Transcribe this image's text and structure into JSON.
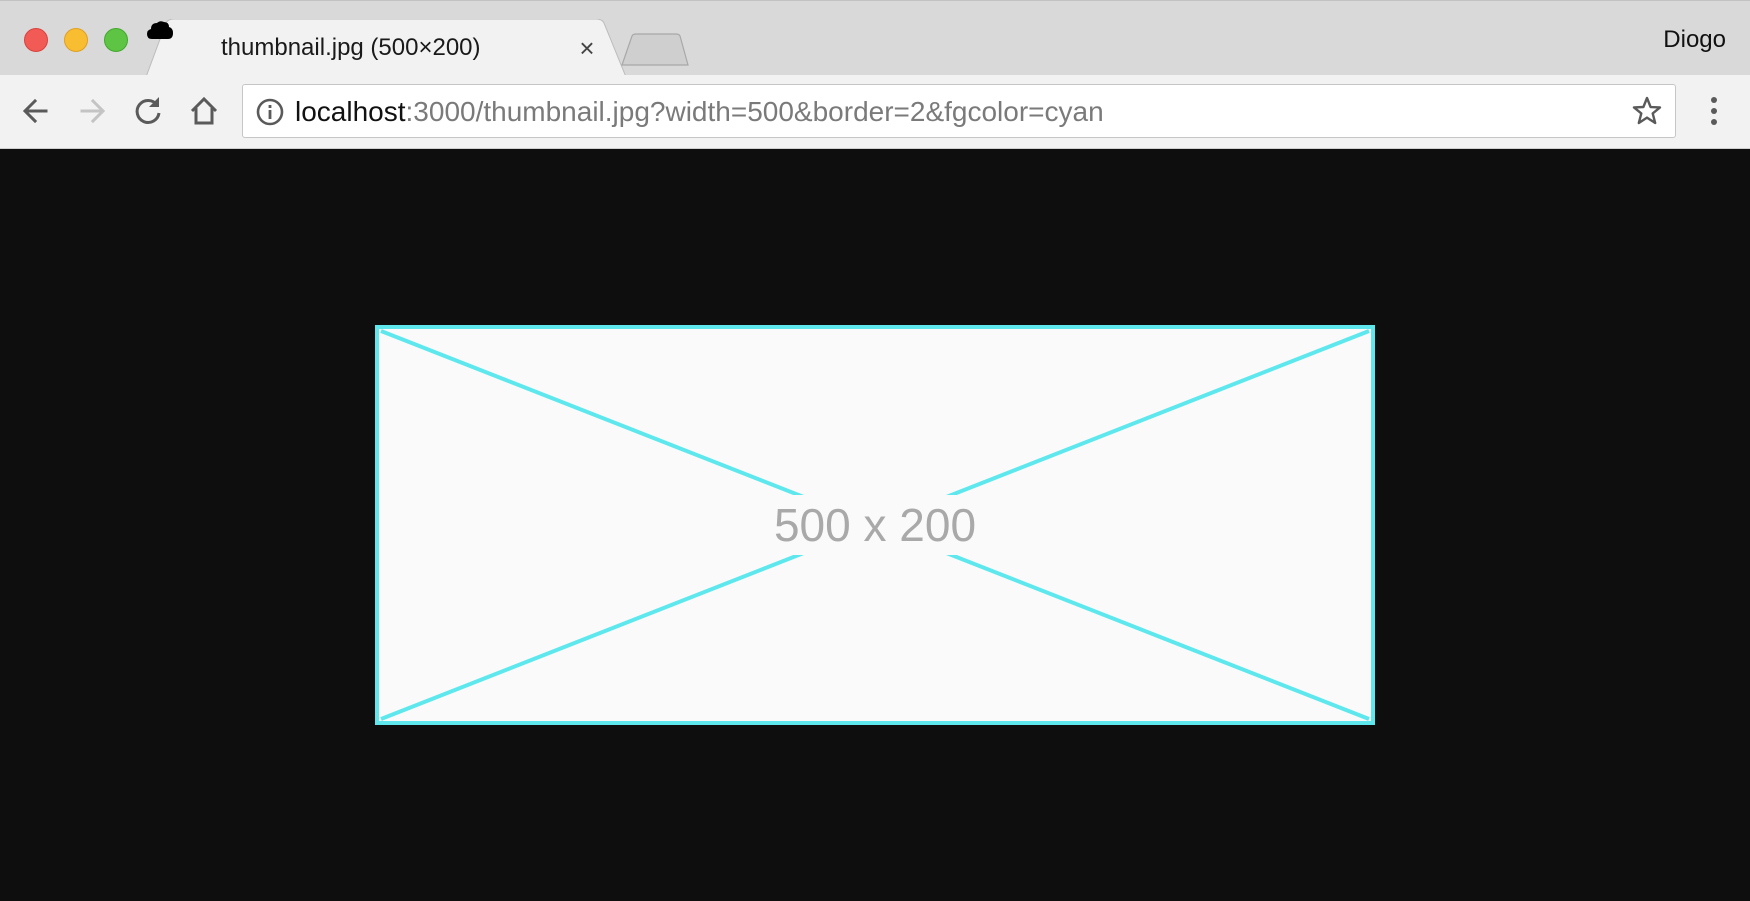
{
  "window": {
    "controls": [
      "close",
      "minimize",
      "maximize"
    ],
    "profile_name": "Diogo"
  },
  "tabs": [
    {
      "title": "thumbnail.jpg (500×200)",
      "favicon": "cloud-icon",
      "active": true
    }
  ],
  "toolbar": {
    "url_host": "localhost",
    "url_rest": ":3000/thumbnail.jpg?width=500&border=2&fgcolor=cyan",
    "icons": [
      "back-arrow-icon",
      "forward-arrow-icon",
      "reload-icon",
      "home-icon",
      "info-icon",
      "star-icon",
      "menu-icon"
    ]
  },
  "content": {
    "image_label": "500 x 200",
    "border_color": "#5ee8ee",
    "image_background": "#fafafa",
    "page_background": "#0e0e0e"
  }
}
